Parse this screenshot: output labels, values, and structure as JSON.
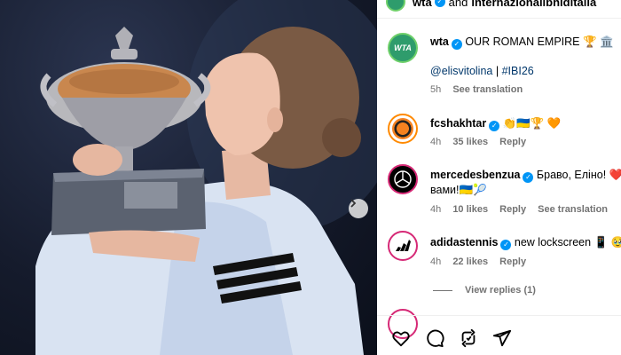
{
  "header": {
    "username": "wta",
    "and_text": "and",
    "collab": "internazionalibnlditalia"
  },
  "caption": {
    "username": "wta",
    "text": "OUR ROMAN EMPIRE 🏆 🏛️",
    "mention": "@elisvitolina",
    "divider": "|",
    "hashtag": "#IBI26",
    "time": "5h",
    "translate": "See translation",
    "avatar_text": "WTA"
  },
  "comments": [
    {
      "username": "fcshakhtar",
      "text": "👏🇺🇦🏆 🧡",
      "time": "4h",
      "likes": "35 likes",
      "reply": "Reply"
    },
    {
      "username": "mercedesbenzua",
      "text": "Браво, Еліно! ❤️ У",
      "text2": "вами!🇺🇦🎾",
      "time": "4h",
      "likes": "10 likes",
      "reply": "Reply",
      "translate": "See translation"
    },
    {
      "username": "adidastennis",
      "text": "new lockscreen 📱 🥹",
      "time": "4h",
      "likes": "22 likes",
      "reply": "Reply"
    }
  ],
  "view_replies": "View replies (1)",
  "actions": [
    "like-icon",
    "comment-icon",
    "repost-icon",
    "share-icon"
  ],
  "colors": {
    "verified": "#0095f6",
    "link": "#00376b",
    "wta_green": "#2e9c6c"
  }
}
